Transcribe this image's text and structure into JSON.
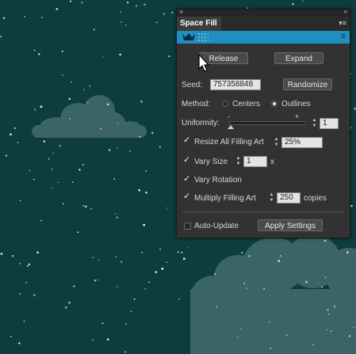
{
  "panel": {
    "close_glyph": "×",
    "collapse_glyph": "«",
    "tab_title": "Space Fill",
    "tab_menu_glyph": "▾≡",
    "banner_icon": "crown-icon",
    "banner_menu_glyph": "≡",
    "release_label": "Release",
    "expand_label": "Expand",
    "seed_label": "Seed:",
    "seed_value": "757358848",
    "randomize_label": "Randomize",
    "method_label": "Method:",
    "method_options": [
      "Centers",
      "Outlines"
    ],
    "method_selected": "Outlines",
    "uniformity_label": "Uniformity:",
    "uniformity_minus": "-",
    "uniformity_plus": "+",
    "uniformity_value": "1",
    "uniformity_level": 0,
    "resize_label": "Resize All Filling Art",
    "resize_checked": true,
    "resize_value": "25%",
    "vary_size_label": "Vary Size",
    "vary_size_checked": true,
    "vary_size_value": "1",
    "vary_size_suffix": "x",
    "vary_rotation_label": "Vary Rotation",
    "vary_rotation_checked": true,
    "multiply_label": "Multiply Filling Art",
    "multiply_checked": true,
    "multiply_value": "250",
    "multiply_suffix": "copies",
    "auto_update_label": "Auto-Update",
    "auto_update_checked": false,
    "apply_label": "Apply Settings",
    "check_glyph": "✓",
    "spin_glyph_up": "▲",
    "spin_glyph_down": "▼"
  },
  "colors": {
    "background": "#0e3d3f",
    "cloud": "#3a6468",
    "panel": "#323232",
    "banner": "#1f8fc0"
  }
}
